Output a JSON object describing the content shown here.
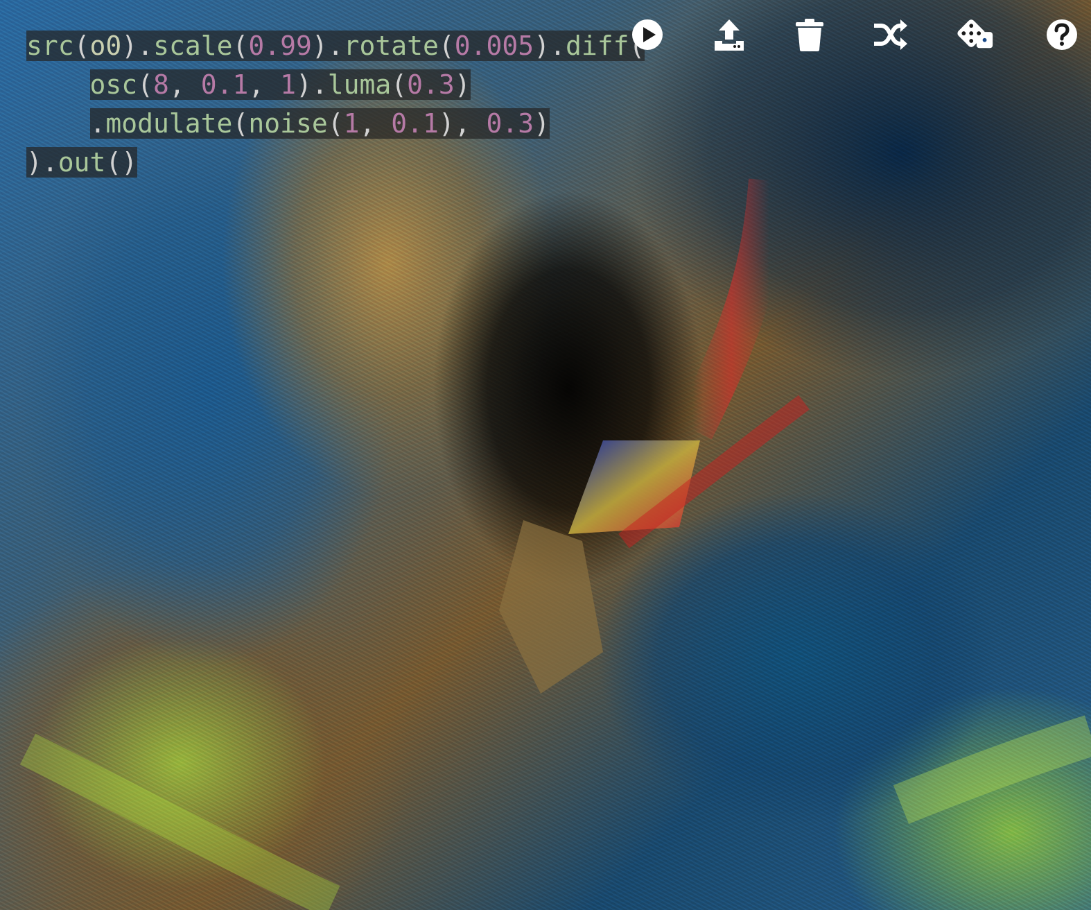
{
  "editor": {
    "lines": [
      [
        {
          "t": "src",
          "c": "tok-fn"
        },
        {
          "t": "(",
          "c": "tok-p"
        },
        {
          "t": "o0",
          "c": "tok-id"
        },
        {
          "t": ").",
          "c": "tok-p"
        },
        {
          "t": "scale",
          "c": "tok-fn"
        },
        {
          "t": "(",
          "c": "tok-p"
        },
        {
          "t": "0.99",
          "c": "tok-num"
        },
        {
          "t": ").",
          "c": "tok-p"
        },
        {
          "t": "rotate",
          "c": "tok-fn"
        },
        {
          "t": "(",
          "c": "tok-p"
        },
        {
          "t": "0.005",
          "c": "tok-num"
        },
        {
          "t": ").",
          "c": "tok-p"
        },
        {
          "t": "diff",
          "c": "tok-fn"
        },
        {
          "t": "(",
          "c": "tok-p"
        }
      ],
      [
        {
          "t": "    ",
          "c": "tok-p",
          "nobg": true
        },
        {
          "t": "osc",
          "c": "tok-fn"
        },
        {
          "t": "(",
          "c": "tok-p"
        },
        {
          "t": "8",
          "c": "tok-num"
        },
        {
          "t": ", ",
          "c": "tok-p"
        },
        {
          "t": "0.1",
          "c": "tok-num"
        },
        {
          "t": ", ",
          "c": "tok-p"
        },
        {
          "t": "1",
          "c": "tok-num"
        },
        {
          "t": ").",
          "c": "tok-p"
        },
        {
          "t": "luma",
          "c": "tok-fn"
        },
        {
          "t": "(",
          "c": "tok-p"
        },
        {
          "t": "0.3",
          "c": "tok-num"
        },
        {
          "t": ")",
          "c": "tok-p"
        }
      ],
      [
        {
          "t": "    ",
          "c": "tok-p",
          "nobg": true
        },
        {
          "t": ".",
          "c": "tok-p"
        },
        {
          "t": "modulate",
          "c": "tok-fn"
        },
        {
          "t": "(",
          "c": "tok-p"
        },
        {
          "t": "noise",
          "c": "tok-fn"
        },
        {
          "t": "(",
          "c": "tok-p"
        },
        {
          "t": "1",
          "c": "tok-num"
        },
        {
          "t": ", ",
          "c": "tok-p"
        },
        {
          "t": "0.1",
          "c": "tok-num"
        },
        {
          "t": "), ",
          "c": "tok-p"
        },
        {
          "t": "0.3",
          "c": "tok-num"
        },
        {
          "t": ")",
          "c": "tok-p"
        }
      ],
      [
        {
          "t": ").",
          "c": "tok-p"
        },
        {
          "t": "out",
          "c": "tok-fn"
        },
        {
          "t": "()",
          "c": "tok-p"
        }
      ]
    ]
  },
  "toolbar": {
    "buttons": [
      {
        "name": "run-button",
        "icon": "play-icon"
      },
      {
        "name": "upload-button",
        "icon": "upload-icon"
      },
      {
        "name": "clear-button",
        "icon": "trash-icon"
      },
      {
        "name": "shuffle-button",
        "icon": "shuffle-icon"
      },
      {
        "name": "random-button",
        "icon": "dice-icon"
      },
      {
        "name": "help-button",
        "icon": "help-icon"
      }
    ]
  },
  "colors": {
    "icon": "#ffffff",
    "code_bg": "#262626",
    "code_fn": "#a9c79a",
    "code_num": "#b67aa6"
  }
}
